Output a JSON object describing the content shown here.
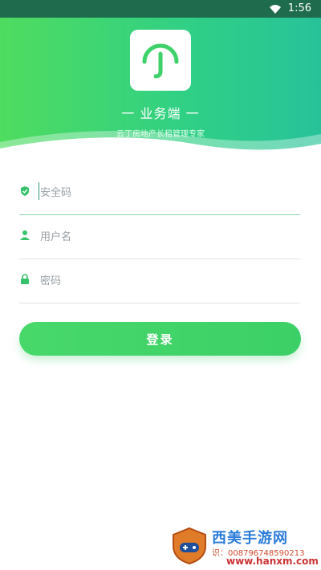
{
  "status": {
    "time": "1:56"
  },
  "hero": {
    "title": "一 业务端 一",
    "subtitle": "云丁房地产长租管理专家"
  },
  "form": {
    "security_code": {
      "placeholder": "安全码",
      "value": ""
    },
    "username": {
      "placeholder": "用户名",
      "value": ""
    },
    "password": {
      "placeholder": "密码",
      "value": ""
    },
    "login_label": "登录"
  },
  "watermark": {
    "title": "西美手游网",
    "id_text": "识：00879674859021​3",
    "url": "www.hanxm.com"
  },
  "colors": {
    "accent": "#3fd26a",
    "teal": "#28c29a",
    "statusbar": "#1f6b4d"
  }
}
